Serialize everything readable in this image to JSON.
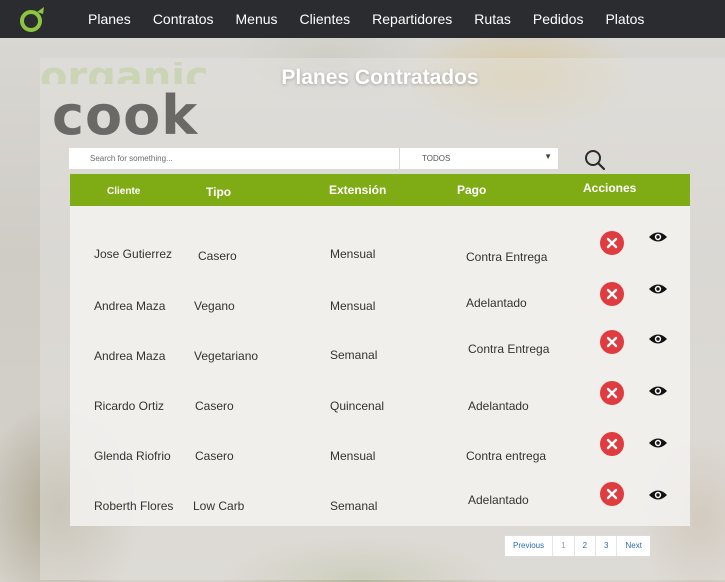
{
  "nav": {
    "items": [
      "Planes",
      "Contratos",
      "Menus",
      "Clientes",
      "Repartidores",
      "Rutas",
      "Pedidos",
      "Platos"
    ]
  },
  "brand": {
    "logo_text": "cook",
    "logo_text_top": "organic"
  },
  "page": {
    "title": "Planes Contratados"
  },
  "search": {
    "placeholder": "Search for something...",
    "value": ""
  },
  "filter": {
    "selected": "TODOS"
  },
  "table": {
    "headers": {
      "cliente": "Cliente",
      "tipo": "Tipo",
      "extension": "Extensión",
      "pago": "Pago",
      "acciones": "Acciones"
    },
    "rows": [
      {
        "cliente": "Jose Gutierrez",
        "tipo": "Casero",
        "extension": "Mensual",
        "pago": "Contra Entrega"
      },
      {
        "cliente": "Andrea Maza",
        "tipo": "Vegano",
        "extension": "Mensual",
        "pago": "Adelantado"
      },
      {
        "cliente": "Andrea Maza",
        "tipo": "Vegetariano",
        "extension": "Semanal",
        "pago": "Contra Entrega"
      },
      {
        "cliente": "Ricardo Ortiz",
        "tipo": "Casero",
        "extension": "Quincenal",
        "pago": "Adelantado"
      },
      {
        "cliente": "Glenda Riofrio",
        "tipo": "Casero",
        "extension": "Mensual",
        "pago": "Contra entrega"
      },
      {
        "cliente": "Roberth Flores",
        "tipo": "Low Carb",
        "extension": "Semanal",
        "pago": "Adelantado"
      }
    ]
  },
  "pagination": {
    "previous": "Previous",
    "pages": [
      "1",
      "2",
      "3"
    ],
    "next": "Next"
  },
  "colors": {
    "nav_bg": "#2b2c30",
    "header_green": "#7fab14",
    "delete_red": "#e03b3f",
    "brand_green": "#8cc63f"
  }
}
